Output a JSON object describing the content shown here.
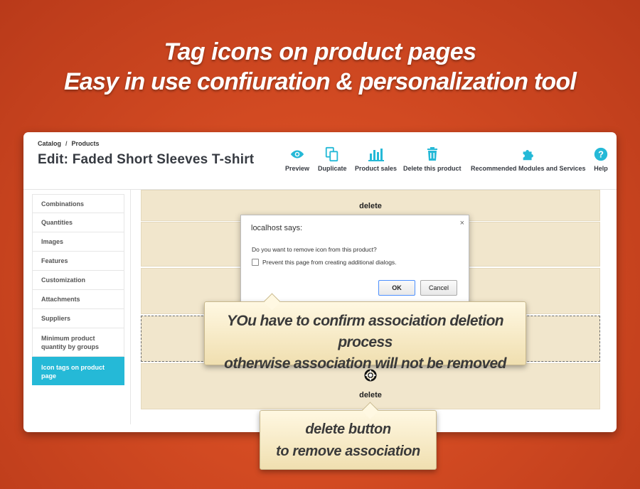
{
  "headline": {
    "line1": "Tag icons on product pages",
    "line2": "Easy in use confiuration & personalization tool"
  },
  "breadcrumb": {
    "item1": "Catalog",
    "separator": "/",
    "item2": "Products"
  },
  "page_title": "Edit: Faded Short Sleeves T-shirt",
  "toolbar": {
    "preview": "Preview",
    "duplicate": "Duplicate",
    "product_sales": "Product sales",
    "delete_product": "Delete this product",
    "recommended": "Recommended Modules and Services",
    "help": "Help"
  },
  "sidebar": {
    "items": [
      "Combinations",
      "Quantities",
      "Images",
      "Features",
      "Customization",
      "Attachments",
      "Suppliers",
      "Minimum product quantity by groups",
      "Icon tags on product page"
    ]
  },
  "rows": {
    "delete_top": "delete",
    "delete_bottom": "delete"
  },
  "dialog": {
    "title": "localhost says:",
    "close": "×",
    "message": "Do you want to remove icon from this product?",
    "checkbox": "Prevent this page from creating additional dialogs.",
    "ok": "OK",
    "cancel": "Cancel"
  },
  "callout_confirm": {
    "line1": "YOu have to confirm association deletion process",
    "line2": "otherwise association will not be removed"
  },
  "callout_delete": {
    "line1": "delete button",
    "line2": "to remove association"
  },
  "colors": {
    "accent": "#25b9d7",
    "background": "#d24a22",
    "row": "#f1e6cc"
  }
}
